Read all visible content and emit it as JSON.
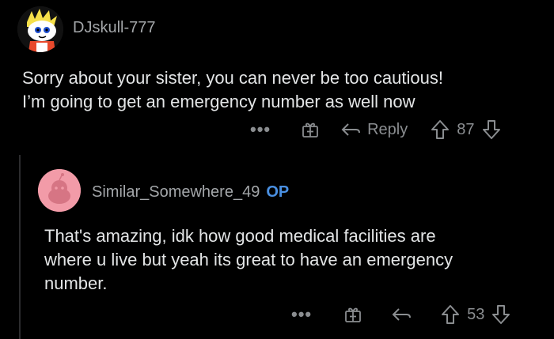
{
  "comments": [
    {
      "username": "DJskull-777",
      "body_lines": [
        "Sorry about your sister, you can never be too cautious!",
        "I’m going to get an emergency number as well now"
      ],
      "actions": {
        "more": "•••",
        "award_icon": "gift-box-icon",
        "reply_label": "Reply",
        "upvote_icon": "arrow-up-icon",
        "score": "87",
        "downvote_icon": "arrow-down-icon"
      }
    },
    {
      "username": "Similar_Somewhere_49",
      "op_badge": "OP",
      "body_lines": [
        "That's amazing, idk how good medical facilities are",
        "where u live but yeah its great to have an emergency",
        "number."
      ],
      "actions": {
        "more": "•••",
        "award_icon": "gift-box-icon",
        "reply_icon": "reply-arrow-icon",
        "upvote_icon": "arrow-up-icon",
        "score": "53",
        "downvote_icon": "arrow-down-icon"
      }
    }
  ],
  "colors": {
    "background": "#000000",
    "text": "#e3e5e6",
    "muted": "#8a8d90",
    "op_badge": "#4a90e2",
    "avatar2_bg": "#f29ba8"
  }
}
